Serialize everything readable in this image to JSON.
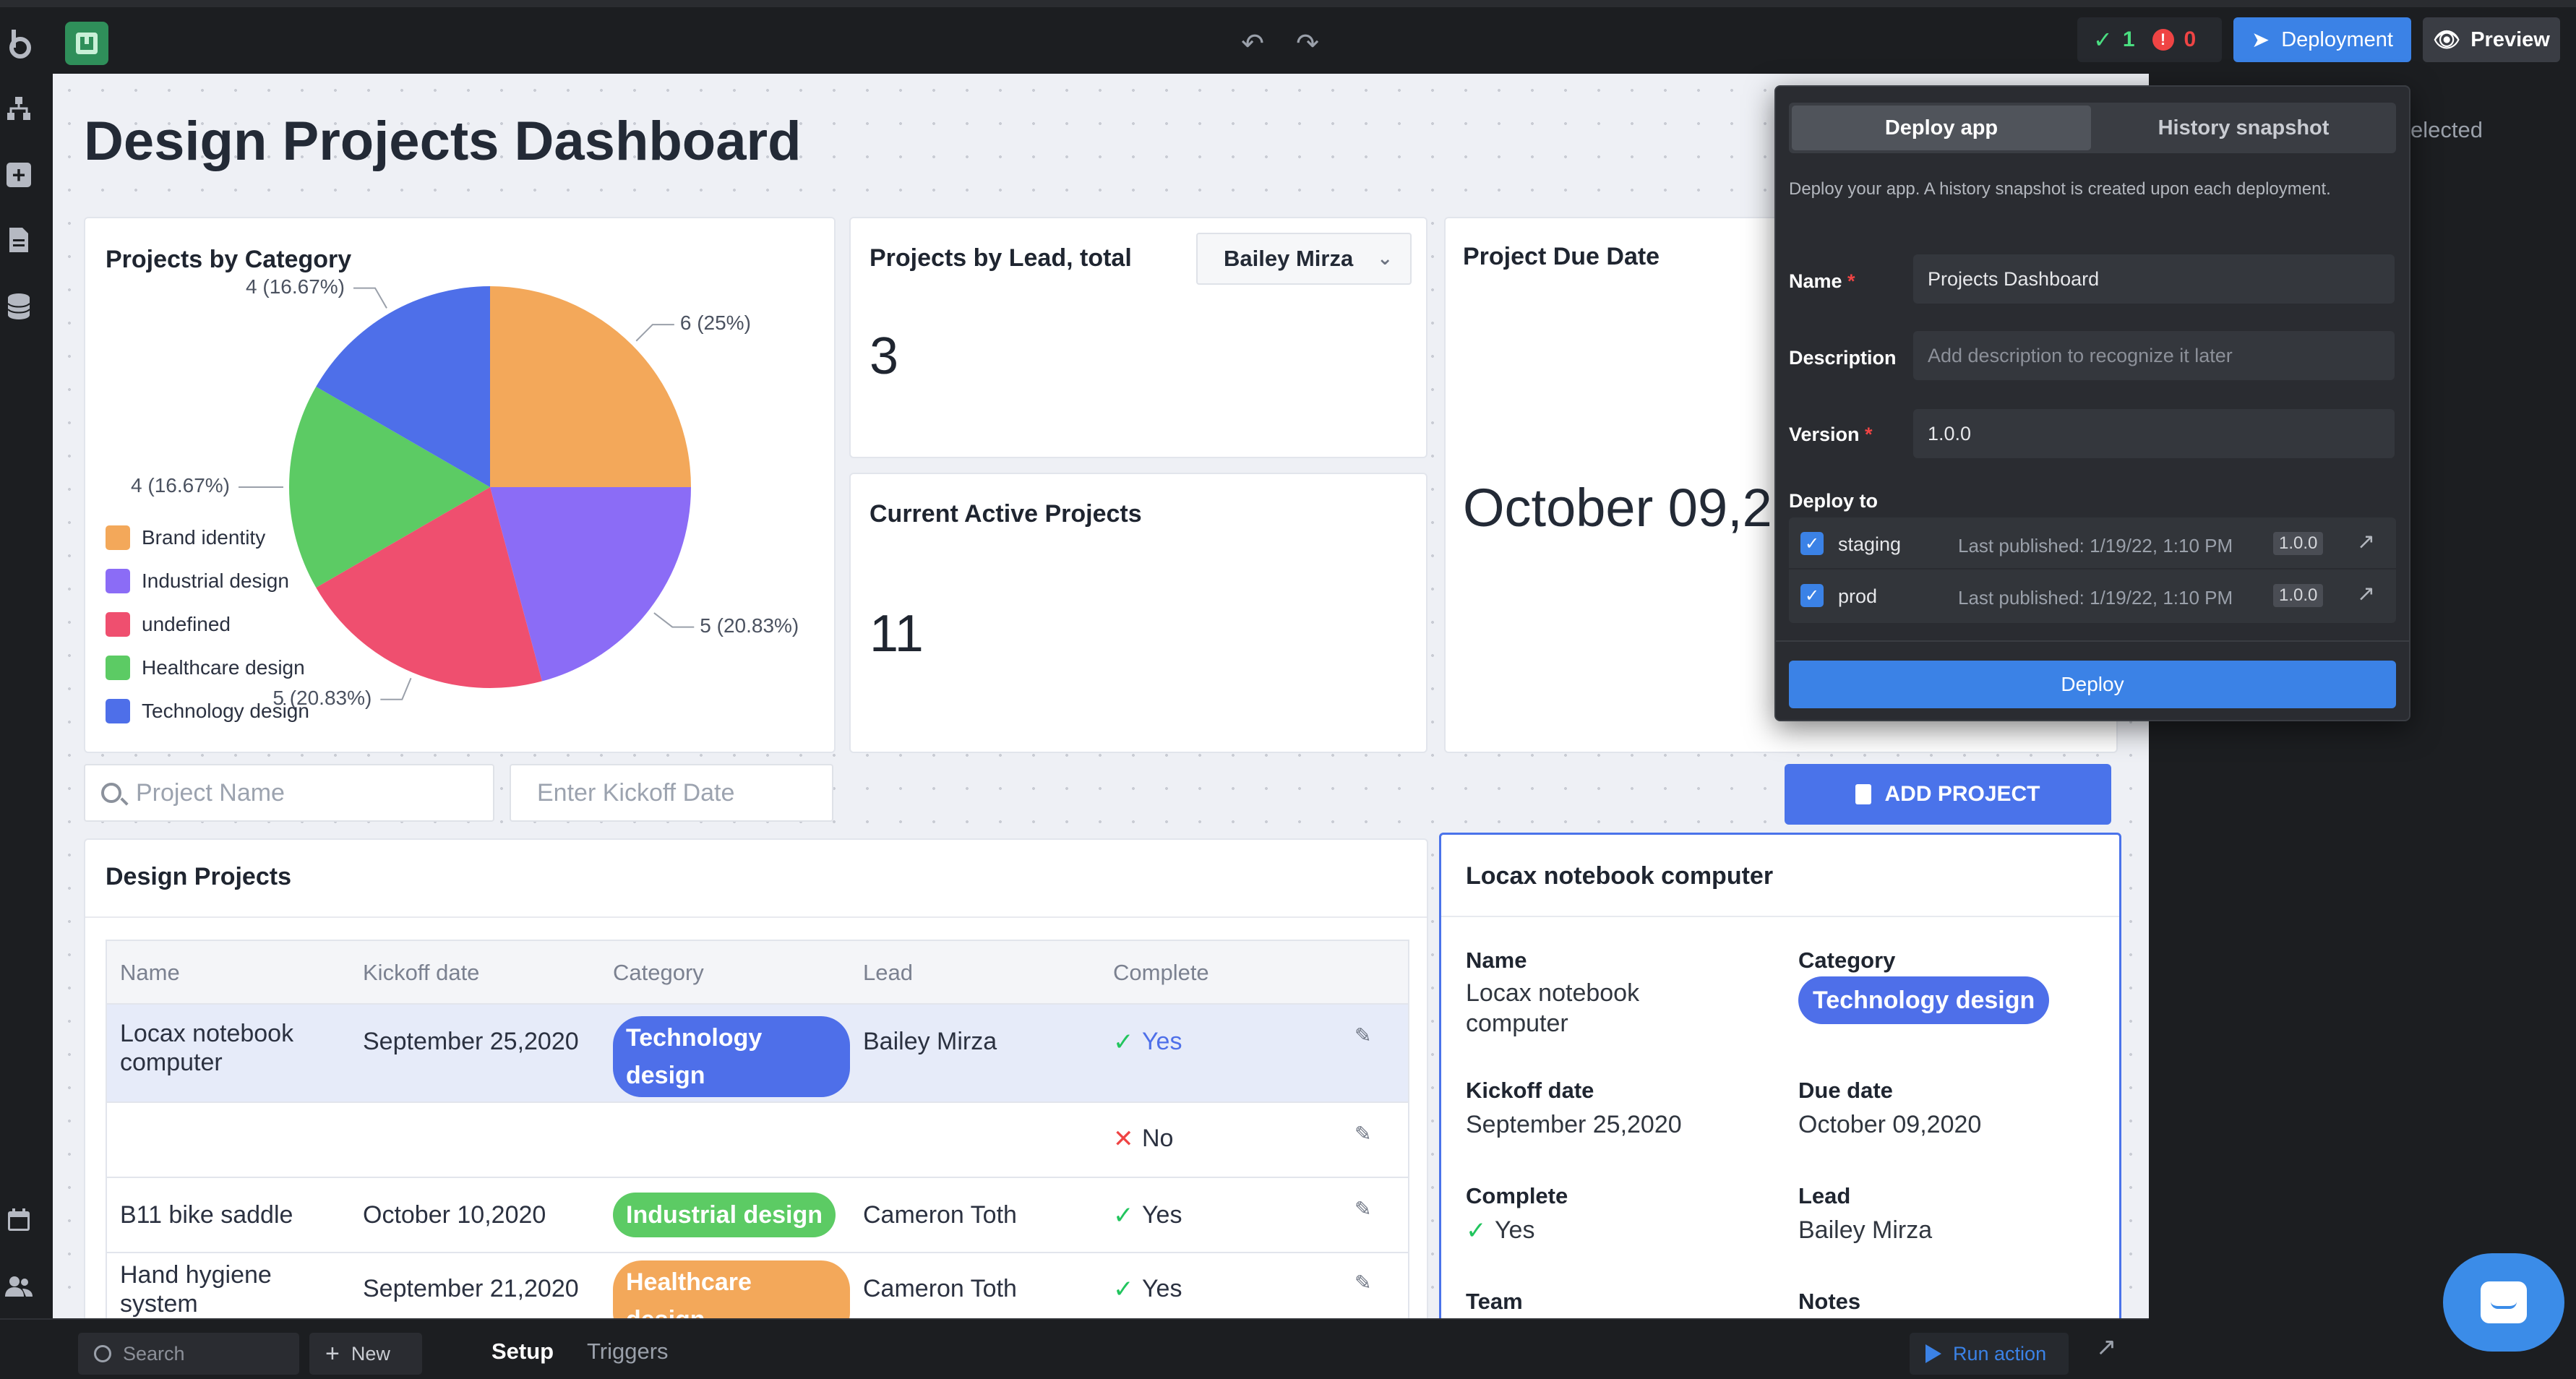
{
  "topbar": {
    "status_ok_count": "1",
    "status_err_count": "0",
    "deployment_label": "Deployment",
    "preview_label": "Preview"
  },
  "page": {
    "title": "Design Projects Dashboard"
  },
  "chart_card": {
    "title": "Projects by Category",
    "legend": [
      "Brand identity",
      "Industrial design",
      "undefined",
      "Healthcare design",
      "Technology design"
    ],
    "colors": [
      "#f3a85a",
      "#8b6cf6",
      "#ef4f6f",
      "#5ccb64",
      "#4e6fe9"
    ],
    "slice_labels": [
      "6 (25%)",
      "5 (20.83%)",
      "5 (20.83%)",
      "4 (16.67%)",
      "4 (16.67%)"
    ]
  },
  "chart_data": {
    "type": "pie",
    "title": "Projects by Category",
    "categories": [
      "Brand identity",
      "Industrial design",
      "undefined",
      "Healthcare design",
      "Technology design"
    ],
    "values": [
      6,
      5,
      5,
      4,
      4
    ],
    "percents": [
      25,
      20.83,
      20.83,
      16.67,
      16.67
    ],
    "legend_position": "left-bottom"
  },
  "lead_card": {
    "title": "Projects by Lead, total",
    "select_value": "Bailey Mirza",
    "value": "3"
  },
  "active_card": {
    "title": "Current Active Projects",
    "value": "11"
  },
  "due_card": {
    "title": "Project Due Date",
    "value": "October 09,2"
  },
  "filters": {
    "project_name_placeholder": "Project Name",
    "kickoff_placeholder": "Enter Kickoff Date",
    "add_label": "ADD PROJECT"
  },
  "table": {
    "title": "Design Projects",
    "headers": [
      "Name",
      "Kickoff date",
      "Category",
      "Lead",
      "Complete"
    ],
    "rows": [
      {
        "name": "Locax notebook computer",
        "kickoff": "September 25,2020",
        "category": "Technology design",
        "lead": "Bailey Mirza",
        "complete": "Yes"
      },
      {
        "name": "",
        "kickoff": "",
        "category": "",
        "lead": "",
        "complete": "No"
      },
      {
        "name": "B11 bike saddle",
        "kickoff": "October 10,2020",
        "category": "Industrial design",
        "lead": "Cameron Toth",
        "complete": "Yes"
      },
      {
        "name": "Hand hygiene system",
        "kickoff": "September 21,2020",
        "category": "Healthcare design",
        "lead": "Cameron Toth",
        "complete": "Yes"
      }
    ]
  },
  "detail": {
    "title": "Locax notebook computer",
    "name_label": "Name",
    "name_value": "Locax notebook computer",
    "category_label": "Category",
    "category_value": "Technology design",
    "kickoff_label": "Kickoff date",
    "kickoff_value": "September 25,2020",
    "due_label": "Due date",
    "due_value": "October 09,2020",
    "complete_label": "Complete",
    "complete_value": "Yes",
    "lead_label": "Lead",
    "lead_value": "Bailey Mirza",
    "team_label": "Team",
    "notes_label": "Notes"
  },
  "right_panel": {
    "selected_text": "elected"
  },
  "popover": {
    "tab_deploy": "Deploy app",
    "tab_history": "History snapshot",
    "description": "Deploy your app. A history snapshot is created upon each deployment.",
    "name_label": "Name",
    "name_value": "Projects Dashboard",
    "desc_label": "Description",
    "desc_placeholder": "Add description to recognize it later",
    "version_label": "Version",
    "version_value": "1.0.0",
    "deploy_to_label": "Deploy to",
    "targets": [
      {
        "name": "staging",
        "published": "Last published: 1/19/22, 1:10 PM",
        "version": "1.0.0"
      },
      {
        "name": "prod",
        "published": "Last published: 1/19/22, 1:10 PM",
        "version": "1.0.0"
      }
    ],
    "deploy_button": "Deploy"
  },
  "bottombar": {
    "search_placeholder": "Search",
    "new_label": "New",
    "tab_setup": "Setup",
    "tab_triggers": "Triggers",
    "run_action": "Run action"
  }
}
